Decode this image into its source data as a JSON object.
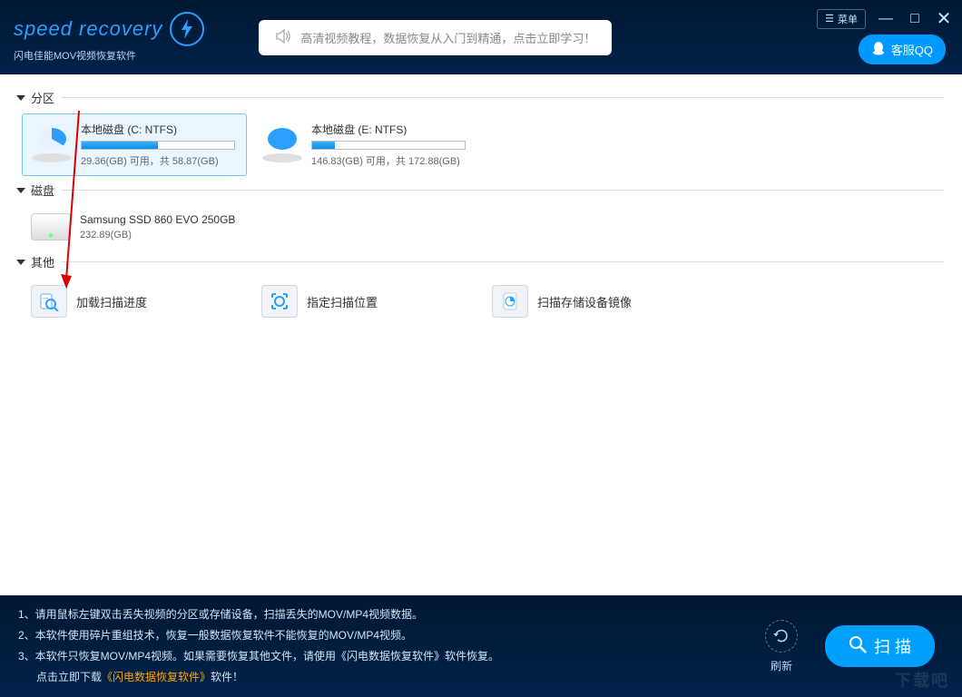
{
  "header": {
    "logo_title": "speed recovery",
    "logo_subtitle": "闪电佳能MOV视频恢复软件",
    "promo_text": "高清视频教程，数据恢复从入门到精通，点击立即学习！",
    "menu_label": "菜单",
    "qq_label": "客服QQ"
  },
  "sections": {
    "partitions_title": "分区",
    "disks_title": "磁盘",
    "others_title": "其他"
  },
  "partitions": [
    {
      "name": "本地磁盘 (C: NTFS)",
      "stats": "29.36(GB) 可用，共 58.87(GB)",
      "fill_pct": 50,
      "selected": true
    },
    {
      "name": "本地磁盘 (E: NTFS)",
      "stats": "146.83(GB) 可用，共 172.88(GB)",
      "fill_pct": 15,
      "selected": false
    }
  ],
  "disks": [
    {
      "name": "Samsung SSD 860 EVO 250GB",
      "stats": "232.89(GB)"
    }
  ],
  "others": [
    {
      "label": "加载扫描进度",
      "icon": "doc-search"
    },
    {
      "label": "指定扫描位置",
      "icon": "target-folder"
    },
    {
      "label": "扫描存储设备镜像",
      "icon": "pie-doc"
    }
  ],
  "footer": {
    "lines": [
      "1、请用鼠标左键双击丢失视频的分区或存储设备，扫描丢失的MOV/MP4视频数据。",
      "2、本软件使用碎片重组技术，恢复一般数据恢复软件不能恢复的MOV/MP4视频。",
      "3、本软件只恢复MOV/MP4视频。如果需要恢复其他文件，请使用《闪电数据恢复软件》软件恢复。"
    ],
    "download_prefix": "点击立即下载",
    "download_link": "《闪电数据恢复软件》",
    "download_suffix": "软件！",
    "refresh_label": "刷新",
    "scan_label": "扫 描",
    "watermark": "下载吧"
  }
}
